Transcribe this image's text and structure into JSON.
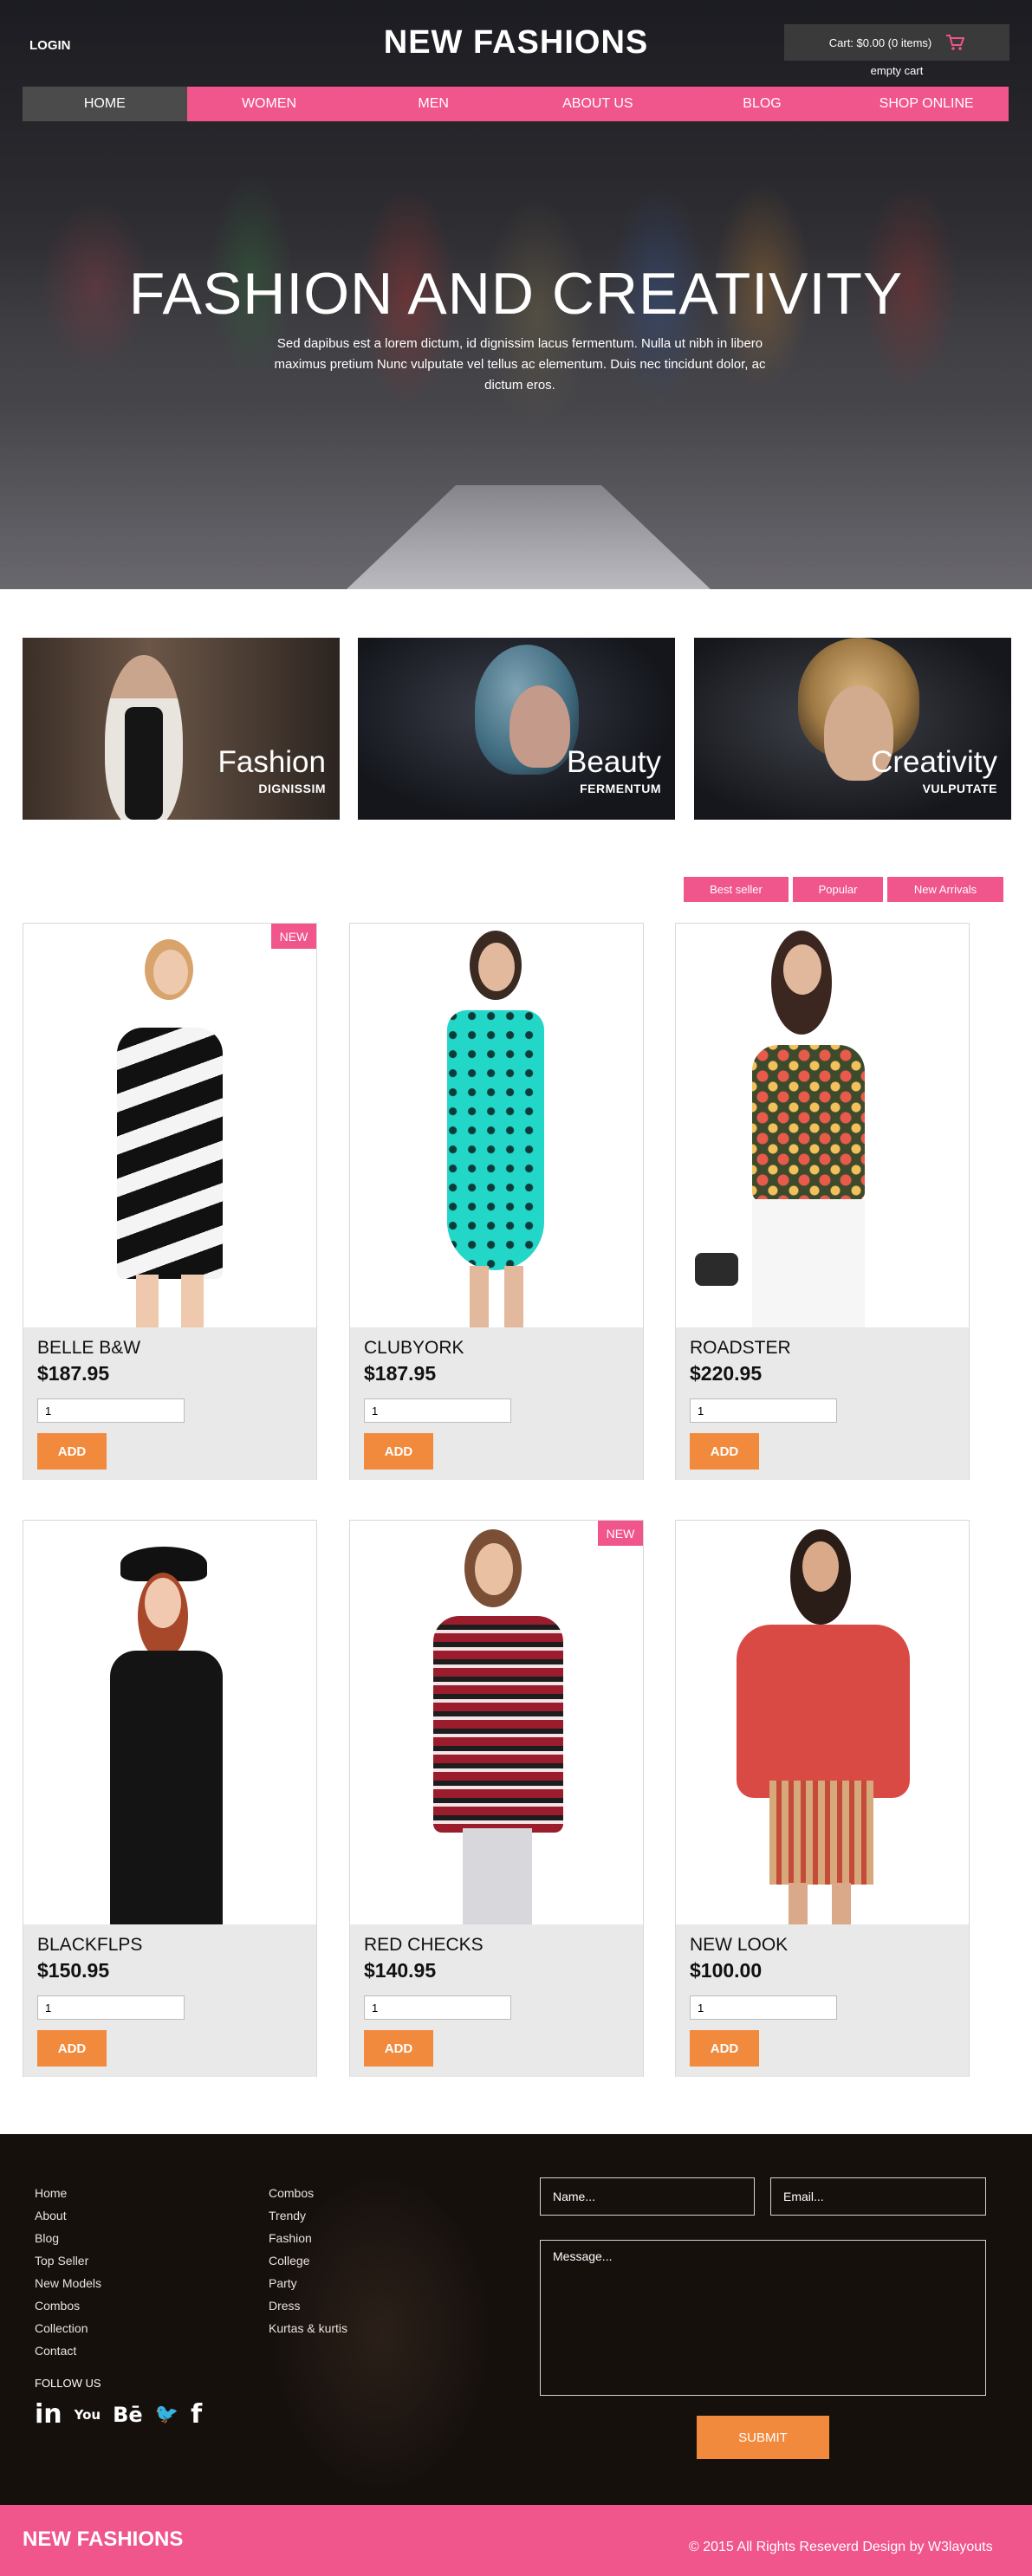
{
  "header": {
    "login_label": "LOGIN",
    "brand": "NEW FASHIONS",
    "cart_label": "Cart: $0.00 (0 items)",
    "empty_cart_label": "empty cart"
  },
  "nav": {
    "items": [
      "HOME",
      "WOMEN",
      "MEN",
      "ABOUT US",
      "BLOG",
      "SHOP ONLINE"
    ],
    "active_index": 0
  },
  "hero": {
    "title": "FASHION AND CREATIVITY",
    "text": "Sed dapibus est a lorem dictum, id dignissim lacus fermentum. Nulla ut nibh in libero maximus pretium Nunc vulputate vel tellus ac elementum. Duis nec tincidunt dolor, ac dictum eros."
  },
  "categories": [
    {
      "title": "Fashion",
      "subtitle": "DIGNISSIM"
    },
    {
      "title": "Beauty",
      "subtitle": "FERMENTUM"
    },
    {
      "title": "Creativity",
      "subtitle": "VULPUTATE"
    }
  ],
  "filter_tabs": [
    "Best seller",
    "Popular",
    "New Arrivals"
  ],
  "products": [
    {
      "name": "BELLE B&W",
      "price": "$187.95",
      "qty": "1",
      "badge": "NEW",
      "add_label": "ADD"
    },
    {
      "name": "CLUBYORK",
      "price": "$187.95",
      "qty": "1",
      "badge": "",
      "add_label": "ADD"
    },
    {
      "name": "ROADSTER",
      "price": "$220.95",
      "qty": "1",
      "badge": "",
      "add_label": "ADD"
    },
    {
      "name": "BLACKFLPS",
      "price": "$150.95",
      "qty": "1",
      "badge": "",
      "add_label": "ADD"
    },
    {
      "name": "RED CHECKS",
      "price": "$140.95",
      "qty": "1",
      "badge": "NEW",
      "add_label": "ADD"
    },
    {
      "name": "NEW LOOK",
      "price": "$100.00",
      "qty": "1",
      "badge": "",
      "add_label": "ADD"
    }
  ],
  "footer": {
    "links_col1": [
      "Home",
      "About",
      "Blog",
      "Top Seller",
      "New Models",
      "Combos",
      "Collection",
      "Contact"
    ],
    "links_col2": [
      "Combos",
      "Trendy",
      "Fashion",
      "College",
      "Party",
      "Dress",
      "Kurtas & kurtis"
    ],
    "follow_label": "FOLLOW US",
    "social": [
      {
        "icon": "linkedin-icon",
        "glyph": "in"
      },
      {
        "icon": "youtube-icon",
        "glyph": "You"
      },
      {
        "icon": "behance-icon",
        "glyph": "Bē"
      },
      {
        "icon": "twitter-icon",
        "glyph": "🐦"
      },
      {
        "icon": "facebook-icon",
        "glyph": "f"
      }
    ],
    "name_placeholder": "Name...",
    "email_placeholder": "Email...",
    "message_placeholder": "Message...",
    "submit_label": "SUBMIT",
    "brand": "NEW FASHIONS",
    "copyright": "© 2015 All Rights Reseverd Design by W3layouts"
  },
  "colors": {
    "accent_pink": "#f0558b",
    "button_orange": "#f28a3d",
    "nav_active": "#4b4b4b"
  }
}
